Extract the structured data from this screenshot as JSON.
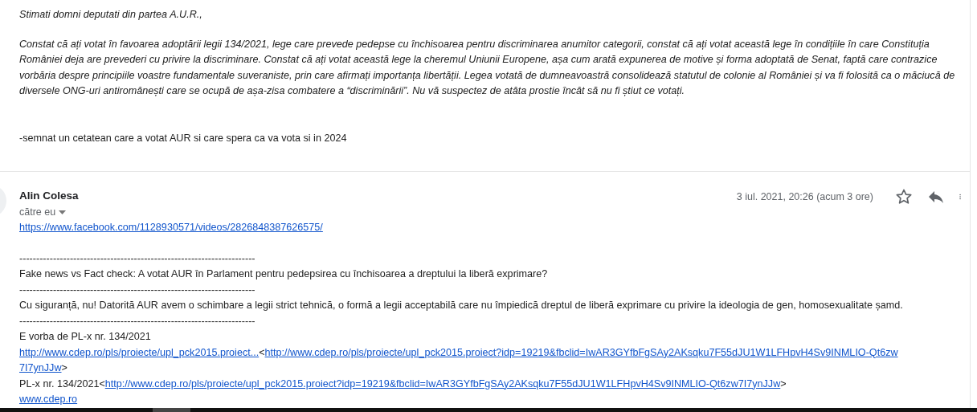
{
  "previous_message": {
    "greeting": "Stimati domni deputati din partea A.U.R.,",
    "paragraph": "Constat că ați votat în favoarea adoptării legii 134/2021, lege care prevede pedepse cu închisoarea pentru discriminarea anumitor categorii, constat că ați votat această lege în condițiile în care Constituția României deja are prevederi cu privire la discriminare. Constat că ați votat această lege la cheremul Uniunii Europene, așa cum arată expunerea de motive și forma adoptată de Senat, faptă care contrazice vorbăria despre principiile voastre fundamentale suveraniste, prin care afirmați importanța libertății. Legea votată de dumneavoastră consolidează statutul de colonie al României și va fi folosită ca o măciucă de diversele ONG-uri antiromânești care se ocupă de așa-zisa combatere a “discriminării”. Nu vă suspectez de atâta prostie încât să nu fi știut ce votați.",
    "signature": "-semnat un cetatean care a votat AUR si care spera ca va vota si in 2024"
  },
  "message": {
    "sender": "Alin Colesa",
    "recipient": "către eu",
    "date": "3 iul. 2021, 20:26 (acum 3 ore)",
    "starred": false,
    "link": "https://www.facebook.com/1128930571/videos/2826848387626575/",
    "lines": [
      {
        "segments": [
          {
            "kind": "text",
            "text": "----------------------------------------------------------------------"
          }
        ]
      },
      {
        "segments": [
          {
            "kind": "text",
            "text": "Fake news vs Fact check: A votat AUR în Parlament pentru pedepsirea cu închisoarea a dreptului la liberă exprimare?"
          }
        ]
      },
      {
        "segments": [
          {
            "kind": "text",
            "text": "----------------------------------------------------------------------"
          }
        ]
      },
      {
        "segments": [
          {
            "kind": "text",
            "text": "Cu siguranță, nu! Datorită AUR avem o schimbare a legii strict tehnică, o formă a legii acceptabilă care nu împiedică dreptul de liberă exprimare cu privire la ideologia de gen, homosexualitate șamd."
          }
        ]
      },
      {
        "segments": [
          {
            "kind": "text",
            "text": "----------------------------------------------------------------------"
          }
        ]
      },
      {
        "segments": [
          {
            "kind": "text",
            "text": "E vorba de PL-x nr. 134/2021"
          }
        ]
      },
      {
        "segments": [
          {
            "kind": "link",
            "text": "http://www.cdep.ro/pls/proiecte/upl_pck2015.proiect..."
          },
          {
            "kind": "text",
            "text": "<"
          },
          {
            "kind": "link",
            "text": "http://www.cdep.ro/pls/proiecte/upl_pck2015.proiect?idp=19219&fbclid=IwAR3GYfbFgSAy2AKsqku7F55dJU1W1LFHpvH4Sv9INMLIO-Qt6zw"
          }
        ]
      },
      {
        "segments": [
          {
            "kind": "link",
            "text": "7I7ynJJw"
          },
          {
            "kind": "text",
            "text": ">"
          }
        ]
      },
      {
        "segments": [
          {
            "kind": "text",
            "text": "PL-x nr. 134/2021<"
          },
          {
            "kind": "link",
            "text": "http://www.cdep.ro/pls/proiecte/upl_pck2015.proiect?idp=19219&fbclid=IwAR3GYfbFgSAy2AKsqku7F55dJU1W1LFHpvH4Sv9INMLIO-Qt6zw7I7ynJJw"
          },
          {
            "kind": "text",
            "text": ">"
          }
        ]
      },
      {
        "segments": [
          {
            "kind": "link",
            "text": "www.cdep.ro"
          }
        ]
      }
    ]
  }
}
